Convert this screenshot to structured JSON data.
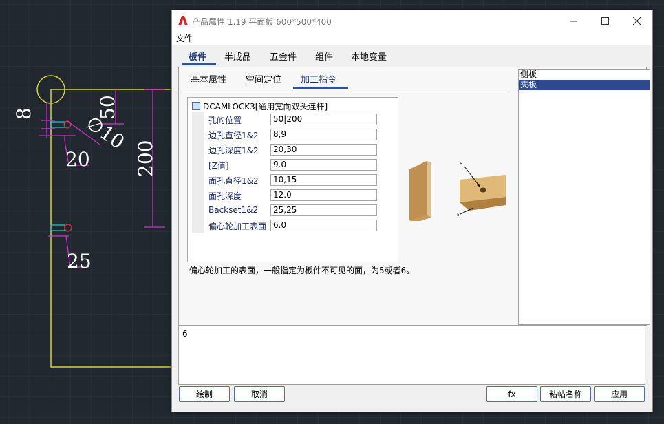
{
  "cad": {
    "dim_8": "8",
    "dim_50": "50",
    "dim_diameter_10": "∅10",
    "dim_20": "20",
    "dim_200": "200",
    "dim_25": "25"
  },
  "window": {
    "title": "产品属性 1.19 平面板 600*500*400",
    "icon": "autocad-a-icon",
    "minimize_icon": "minimize-icon",
    "maximize_icon": "maximize-icon",
    "close_icon": "close-icon"
  },
  "menu": {
    "file": "文件"
  },
  "top_tabs": [
    "板件",
    "半成品",
    "五金件",
    "组件",
    "本地变量"
  ],
  "sub_tabs": [
    "基本属性",
    "空间定位",
    "加工指令"
  ],
  "command": {
    "name": "DCAMLOCK3[通用宽向双头连杆]",
    "rows": [
      {
        "label": "孔的位置",
        "value": "50|200"
      },
      {
        "label": "边孔直径1&2",
        "value": "8,9"
      },
      {
        "label": "边孔深度1&2",
        "value": "20,30"
      },
      {
        "label": "[Z值]",
        "value": "9.0"
      },
      {
        "label": "面孔直径1&2",
        "value": "10,15"
      },
      {
        "label": "面孔深度",
        "value": "12.0"
      },
      {
        "label": "Backset1&2",
        "value": "25,25"
      },
      {
        "label": "偏心轮加工表面",
        "value": "6.0"
      }
    ]
  },
  "preview": {
    "label_6": "6",
    "label_5": "5"
  },
  "hint": "偏心轮加工的表面，一般指定为板件不可见的面，为5或者6。",
  "side_list": [
    {
      "label": "侧板",
      "selected": false
    },
    {
      "label": "夹板",
      "selected": true
    }
  ],
  "editor_value": "6",
  "buttons": {
    "draw": "绘制",
    "cancel": "取消",
    "fx": "fx",
    "paste_name": "粘帖名称",
    "apply": "应用"
  },
  "colors": {
    "cad_bg": "#212830",
    "outline": "#d6d233",
    "dimension": "#d92bd9",
    "accent": "#2c5597"
  }
}
